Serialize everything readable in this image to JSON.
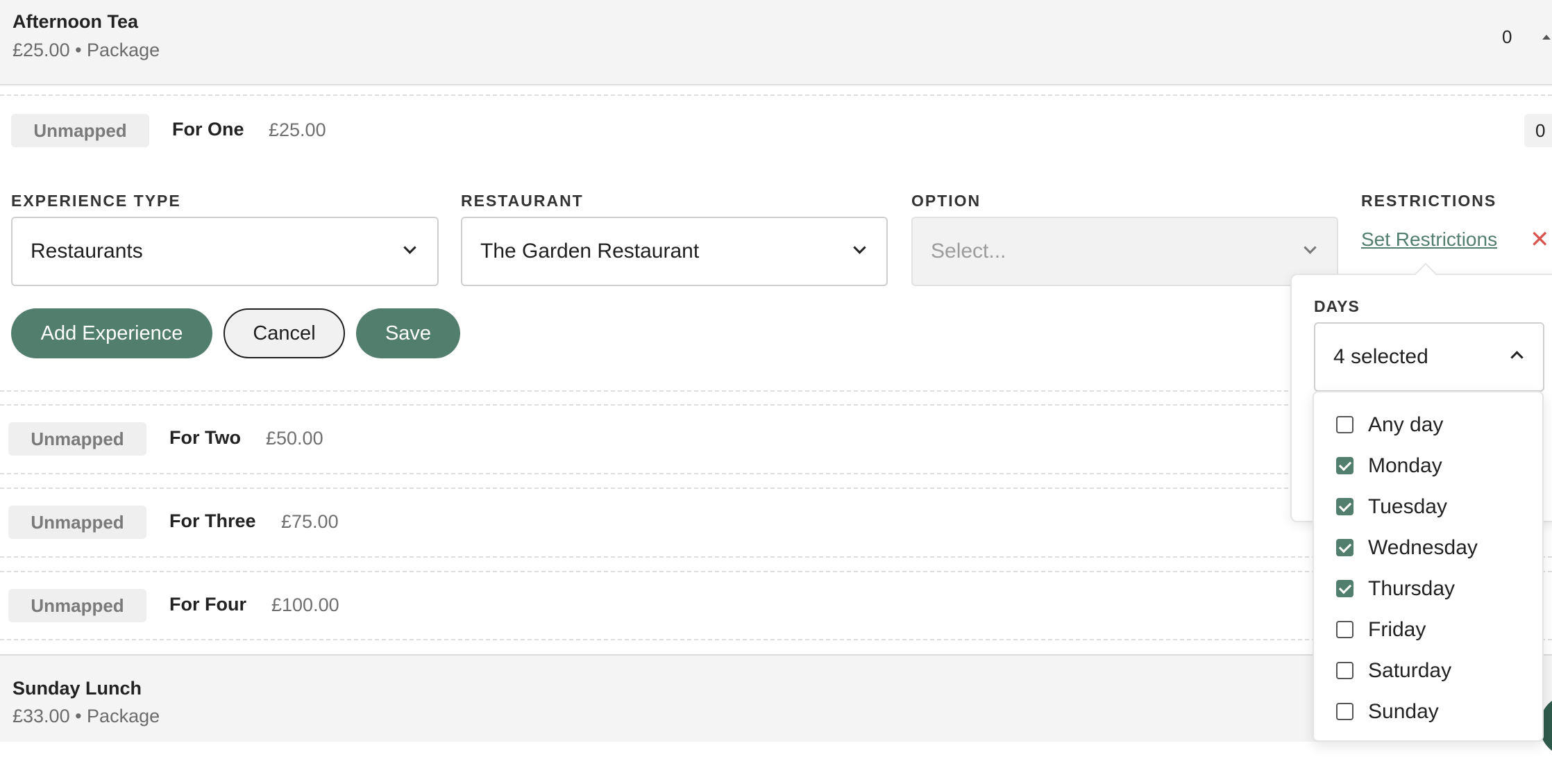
{
  "packages": [
    {
      "title": "Afternoon Tea",
      "subtitle": "£25.00 • Package",
      "count": "0"
    },
    {
      "title": "Sunday Lunch",
      "subtitle": "£33.00 • Package"
    }
  ],
  "variants": [
    {
      "badge": "Unmapped",
      "name": "For One",
      "price": "£25.00",
      "count": "0"
    },
    {
      "badge": "Unmapped",
      "name": "For Two",
      "price": "£50.00"
    },
    {
      "badge": "Unmapped",
      "name": "For Three",
      "price": "£75.00"
    },
    {
      "badge": "Unmapped",
      "name": "For Four",
      "price": "£100.00"
    }
  ],
  "editor": {
    "experience_type": {
      "label": "EXPERIENCE TYPE",
      "value": "Restaurants"
    },
    "restaurant": {
      "label": "RESTAURANT",
      "value": "The Garden Restaurant"
    },
    "option": {
      "label": "OPTION",
      "placeholder": "Select..."
    },
    "restrictions": {
      "label": "RESTRICTIONS",
      "link": "Set Restrictions",
      "remove": "✕"
    },
    "buttons": {
      "add": "Add Experience",
      "cancel": "Cancel",
      "save": "Save"
    }
  },
  "restrictions_popover": {
    "days_label": "DAYS",
    "days_value": "4 selected",
    "options": [
      {
        "label": "Any day",
        "checked": false
      },
      {
        "label": "Monday",
        "checked": true
      },
      {
        "label": "Tuesday",
        "checked": true
      },
      {
        "label": "Wednesday",
        "checked": true
      },
      {
        "label": "Thursday",
        "checked": true
      },
      {
        "label": "Friday",
        "checked": false
      },
      {
        "label": "Saturday",
        "checked": false
      },
      {
        "label": "Sunday",
        "checked": false
      }
    ]
  },
  "colors": {
    "accent": "#527e6e",
    "danger": "#d9534f",
    "badge_bg": "#efefef",
    "header_bg": "#f4f4f4"
  }
}
